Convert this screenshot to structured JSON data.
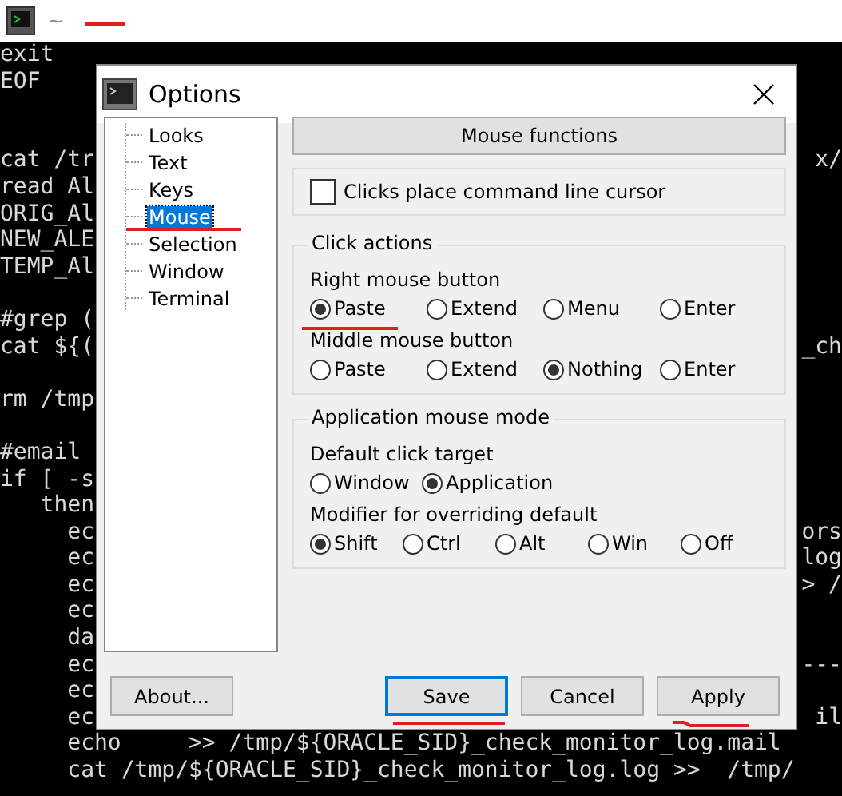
{
  "top_bar": {
    "title": "~"
  },
  "terminal_blocks": [
    {
      "kind": "double",
      "lines": [
        {
          "left": "exit"
        },
        {
          "left": "EOF"
        }
      ]
    },
    {
      "kind": "single",
      "lines": [
        {
          "left": "cat /tr",
          "right": "x/"
        },
        {
          "left": "read Al"
        },
        {
          "left": "ORIG_Al"
        },
        {
          "left": "NEW_ALE"
        },
        {
          "left": "TEMP_Al"
        }
      ]
    },
    {
      "kind": "single",
      "lines": [
        {
          "left": "#grep ("
        },
        {
          "left": "cat ${(",
          "right": "_ch"
        }
      ]
    },
    {
      "kind": "single",
      "lines": [
        {
          "left": "rm /tmp"
        }
      ]
    },
    {
      "kind": "last",
      "lines": [
        {
          "left": "#email"
        },
        {
          "left": "if [ -s"
        },
        {
          "left": "   then"
        },
        {
          "left": "     ec",
          "right": "ors"
        },
        {
          "left": "     ec",
          "right": "log"
        },
        {
          "left": "     ec",
          "right": "> /"
        },
        {
          "left": "     ec"
        },
        {
          "left": "     da"
        },
        {
          "left": "     ec",
          "right": "---"
        },
        {
          "left": "     ec"
        },
        {
          "left": "     ec",
          "right": "il"
        },
        {
          "left": "     echo     >> /tmp/${ORACLE_SID}_check_monitor_log.mail"
        },
        {
          "left": "     cat /tmp/${ORACLE_SID}_check_monitor_log.log >>  /tmp/"
        }
      ]
    }
  ],
  "dialog": {
    "title": "Options",
    "sidebar": {
      "items": [
        {
          "label": "Looks",
          "selected": false
        },
        {
          "label": "Text",
          "selected": false
        },
        {
          "label": "Keys",
          "selected": false
        },
        {
          "label": "Mouse",
          "selected": true
        },
        {
          "label": "Selection",
          "selected": false
        },
        {
          "label": "Window",
          "selected": false
        },
        {
          "label": "Terminal",
          "selected": false
        }
      ]
    },
    "section_header": "Mouse functions",
    "checkbox": {
      "label": "Clicks place command line cursor",
      "checked": false
    },
    "groups": [
      {
        "title": "Click actions",
        "rows": [
          {
            "label": "Right mouse button",
            "options": [
              {
                "label": "Paste",
                "selected": true
              },
              {
                "label": "Extend",
                "selected": false
              },
              {
                "label": "Menu",
                "selected": false
              },
              {
                "label": "Enter",
                "selected": false
              }
            ]
          },
          {
            "label": "Middle mouse button",
            "options": [
              {
                "label": "Paste",
                "selected": false
              },
              {
                "label": "Extend",
                "selected": false
              },
              {
                "label": "Nothing",
                "selected": true
              },
              {
                "label": "Enter",
                "selected": false
              }
            ]
          }
        ]
      },
      {
        "title": "Application mouse mode",
        "rows": [
          {
            "label": "Default click target",
            "options": [
              {
                "label": "Window",
                "selected": false
              },
              {
                "label": "Application",
                "selected": true
              }
            ]
          },
          {
            "label": "Modifier for overriding default",
            "options": [
              {
                "label": "Shift",
                "selected": true
              },
              {
                "label": "Ctrl",
                "selected": false
              },
              {
                "label": "Alt",
                "selected": false
              },
              {
                "label": "Win",
                "selected": false
              },
              {
                "label": "Off",
                "selected": false
              }
            ]
          }
        ]
      }
    ],
    "buttons": [
      {
        "label": "About...",
        "default": false
      },
      {
        "label": "Save",
        "default": true
      },
      {
        "label": "Cancel",
        "default": false
      },
      {
        "label": "Apply",
        "default": false
      }
    ]
  }
}
